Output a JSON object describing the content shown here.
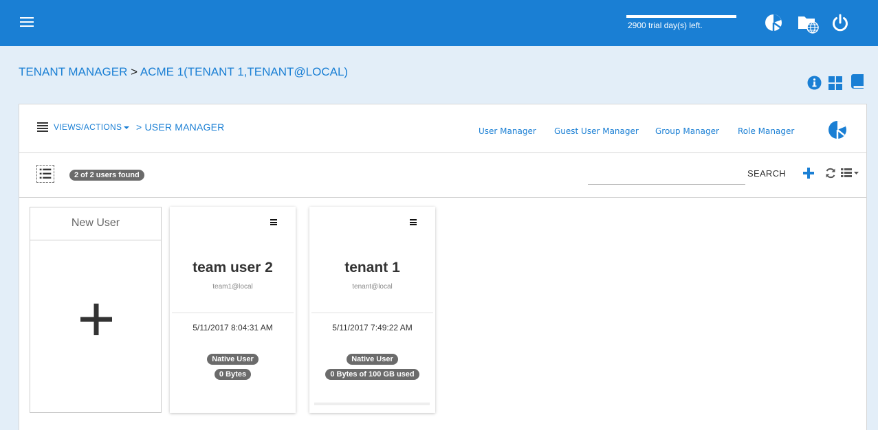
{
  "header": {
    "trial_text": "2900 trial day(s) left.",
    "icons": [
      "dashboard-icon",
      "folder-network-icon",
      "power-icon"
    ]
  },
  "breadcrumb": {
    "root": "TENANT MANAGER",
    "separator": ">",
    "current": "ACME 1(TENANT 1,TENANT@LOCAL)"
  },
  "page_icons": [
    "info-icon",
    "grid-view-icon",
    "book-icon"
  ],
  "panel": {
    "views_label": "VIEWS/ACTIONS",
    "sub_crumb": "> USER MANAGER",
    "nav_links": [
      "User Manager",
      "Guest User Manager",
      "Group Manager",
      "Role Manager"
    ]
  },
  "toolbar": {
    "count_text": "2 of 2 users found",
    "search_placeholder": "",
    "search_label": "SEARCH"
  },
  "new_user": {
    "label": "New User"
  },
  "users": [
    {
      "name": "team user 2",
      "email": "team1@local",
      "date": "5/11/2017 8:04:31 AM",
      "type": "Native User",
      "usage": "0 Bytes"
    },
    {
      "name": "tenant 1",
      "email": "tenant@local",
      "date": "5/11/2017 7:49:22 AM",
      "type": "Native User",
      "usage": "0 Bytes of 100 GB used"
    }
  ],
  "colors": {
    "primary": "#1a7fd4",
    "background": "#e3eef8",
    "badge": "#6b6b6b"
  }
}
